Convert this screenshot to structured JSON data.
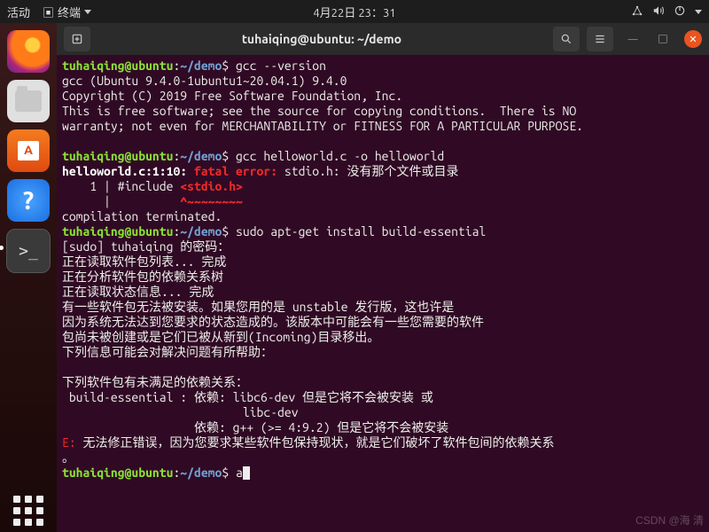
{
  "topbar": {
    "activities": "活动",
    "app_menu": "终端",
    "clock": "4月22日 23：31"
  },
  "dock": {
    "items": [
      {
        "name": "firefox-icon"
      },
      {
        "name": "files-icon"
      },
      {
        "name": "software-center-icon"
      },
      {
        "name": "help-icon"
      },
      {
        "name": "terminal-icon",
        "active": true
      }
    ],
    "apps_button": "show-applications-icon"
  },
  "window": {
    "title": "tuhaiqing@ubuntu: ~/demo",
    "buttons": {
      "new_tab": "+",
      "search": "search",
      "menu": "menu",
      "min": "−",
      "max": "□",
      "close": "×"
    }
  },
  "prompt": {
    "user_host": "tuhaiqing@ubuntu",
    "sep1": ":",
    "path": "~/demo",
    "sep2": "$"
  },
  "terminal": {
    "cmd1": "gcc --version",
    "out1_l1": "gcc (Ubuntu 9.4.0-1ubuntu1~20.04.1) 9.4.0",
    "out1_l2": "Copyright (C) 2019 Free Software Foundation, Inc.",
    "out1_l3": "This is free software; see the source for copying conditions.  There is NO",
    "out1_l4": "warranty; not even for MERCHANTABILITY or FITNESS FOR A PARTICULAR PURPOSE.",
    "cmd2": "gcc helloworld.c -o helloworld",
    "err_loc": "helloworld.c:1:10:",
    "err_fatal": "fatal error:",
    "err_msg": " stdio.h: 没有那个文件或目录",
    "err_line_no": "    1 | ",
    "err_line_code_a": "#include ",
    "err_line_code_b": "<stdio.h>",
    "err_caret_pad": "      |          ",
    "err_caret": "^~~~~~~~~",
    "err_term": "compilation terminated.",
    "cmd3": "sudo apt-get install build-essential",
    "sudo_pw": "[sudo] tuhaiqing 的密码：",
    "apt1": "正在读取软件包列表... 完成",
    "apt2": "正在分析软件包的依赖关系树",
    "apt3": "正在读取状态信息... 完成",
    "apt4": "有一些软件包无法被安装。如果您用的是 unstable 发行版，这也许是",
    "apt5": "因为系统无法达到您要求的状态造成的。该版本中可能会有一些您需要的软件",
    "apt6": "包尚未被创建或是它们已被从新到(Incoming)目录移出。",
    "apt7": "下列信息可能会对解决问题有所帮助：",
    "apt8": "下列软件包有未满足的依赖关系：",
    "apt9": " build-essential : 依赖: libc6-dev 但是它将不会被安装 或",
    "apt10": "                          libc-dev",
    "apt11": "                   依赖: g++ (>= 4:9.2) 但是它将不会被安装",
    "apt_e_tag": "E: ",
    "apt_e_msg": "无法修正错误，因为您要求某些软件包保持现状，就是它们破坏了软件包间的依赖关系",
    "apt_e_dot": "。",
    "cmd4": "a"
  },
  "watermark": "CSDN @海 清"
}
